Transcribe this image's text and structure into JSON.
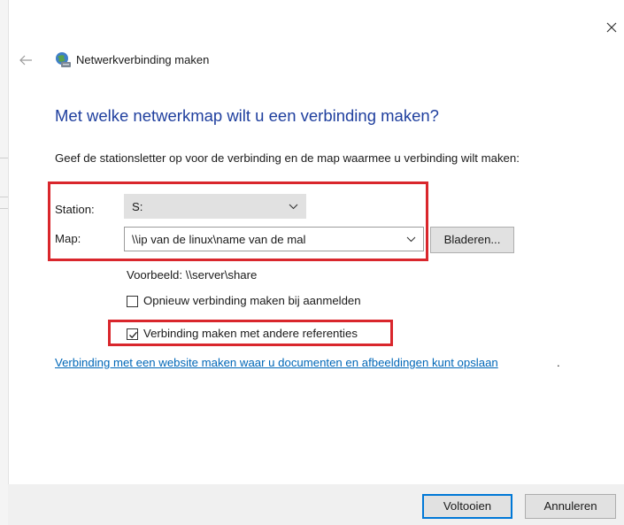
{
  "window": {
    "title": "Netwerkverbinding maken",
    "close_icon": "close-icon",
    "back_icon": "back-arrow-icon",
    "title_icon": "network-drive-icon"
  },
  "main": {
    "heading": "Met welke netwerkmap wilt u een verbinding maken?",
    "instruction": "Geef de stationsletter op voor de verbinding en de map waarmee u verbinding wilt maken:",
    "station": {
      "label": "Station:",
      "value": "S:"
    },
    "map": {
      "label": "Map:",
      "value": "\\\\ip van de linux\\name van de mal",
      "browse_label": "Bladeren..."
    },
    "example": "Voorbeeld: \\\\server\\share",
    "reconnect": {
      "label": "Opnieuw verbinding maken bij aanmelden",
      "checked": false
    },
    "other_credentials": {
      "label": "Verbinding maken met andere referenties",
      "checked": true
    },
    "website_link": "Verbinding met een website maken waar u documenten en afbeeldingen kunt opslaan",
    "website_link_suffix": "."
  },
  "footer": {
    "finish_label": "Voltooien",
    "cancel_label": "Annuleren"
  },
  "colors": {
    "heading": "#1f3f9e",
    "link": "#0067b8",
    "highlight": "#d9262c",
    "focus": "#0078d7"
  }
}
